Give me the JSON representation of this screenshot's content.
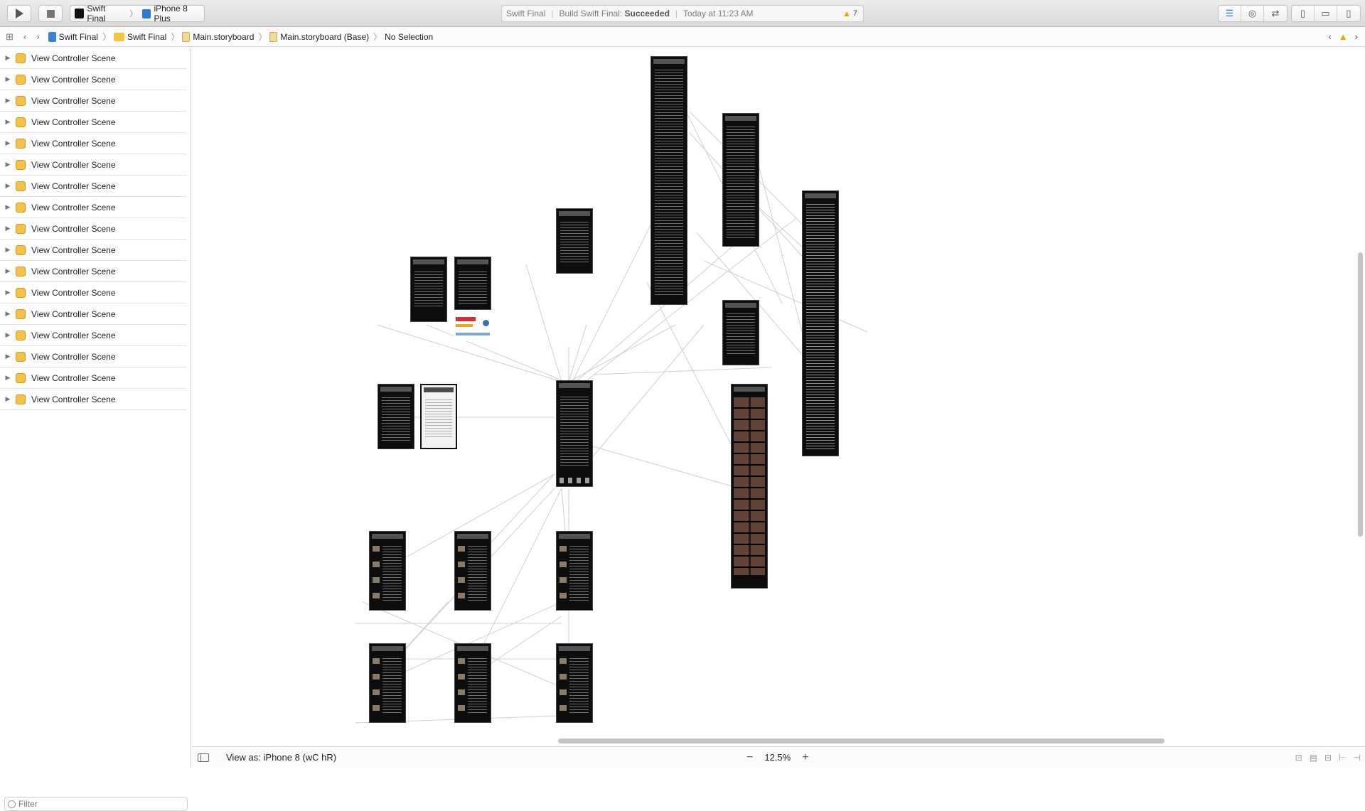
{
  "toolbar": {
    "scheme_name": "Swift Final",
    "device_name": "iPhone 8 Plus",
    "activity": {
      "project": "Swift Final",
      "build_label": "Build Swift Final:",
      "build_status": "Succeeded",
      "time": "Today at 11:23 AM",
      "warning_count": "7"
    }
  },
  "jumpbar": {
    "crumbs": [
      "Swift Final",
      "Swift Final",
      "Main.storyboard",
      "Main.storyboard (Base)",
      "No Selection"
    ]
  },
  "navigator": {
    "scenes": [
      "View Controller Scene",
      "View Controller Scene",
      "View Controller Scene",
      "View Controller Scene",
      "View Controller Scene",
      "View Controller Scene",
      "View Controller Scene",
      "View Controller Scene",
      "View Controller Scene",
      "View Controller Scene",
      "View Controller Scene",
      "View Controller Scene",
      "View Controller Scene",
      "View Controller Scene",
      "View Controller Scene",
      "View Controller Scene",
      "View Controller Scene"
    ],
    "filter_placeholder": "Filter"
  },
  "bottombar": {
    "view_as": "View as: iPhone 8 (wC hR)",
    "zoom": "12.5%"
  },
  "icons": {
    "run": "play-icon",
    "stop": "stop-icon",
    "warning": "warning-triangle-icon"
  },
  "colors": {
    "warning": "#e9a500",
    "scene_icon": "#f4c24a",
    "scene_dark": "#0d0d0d"
  }
}
